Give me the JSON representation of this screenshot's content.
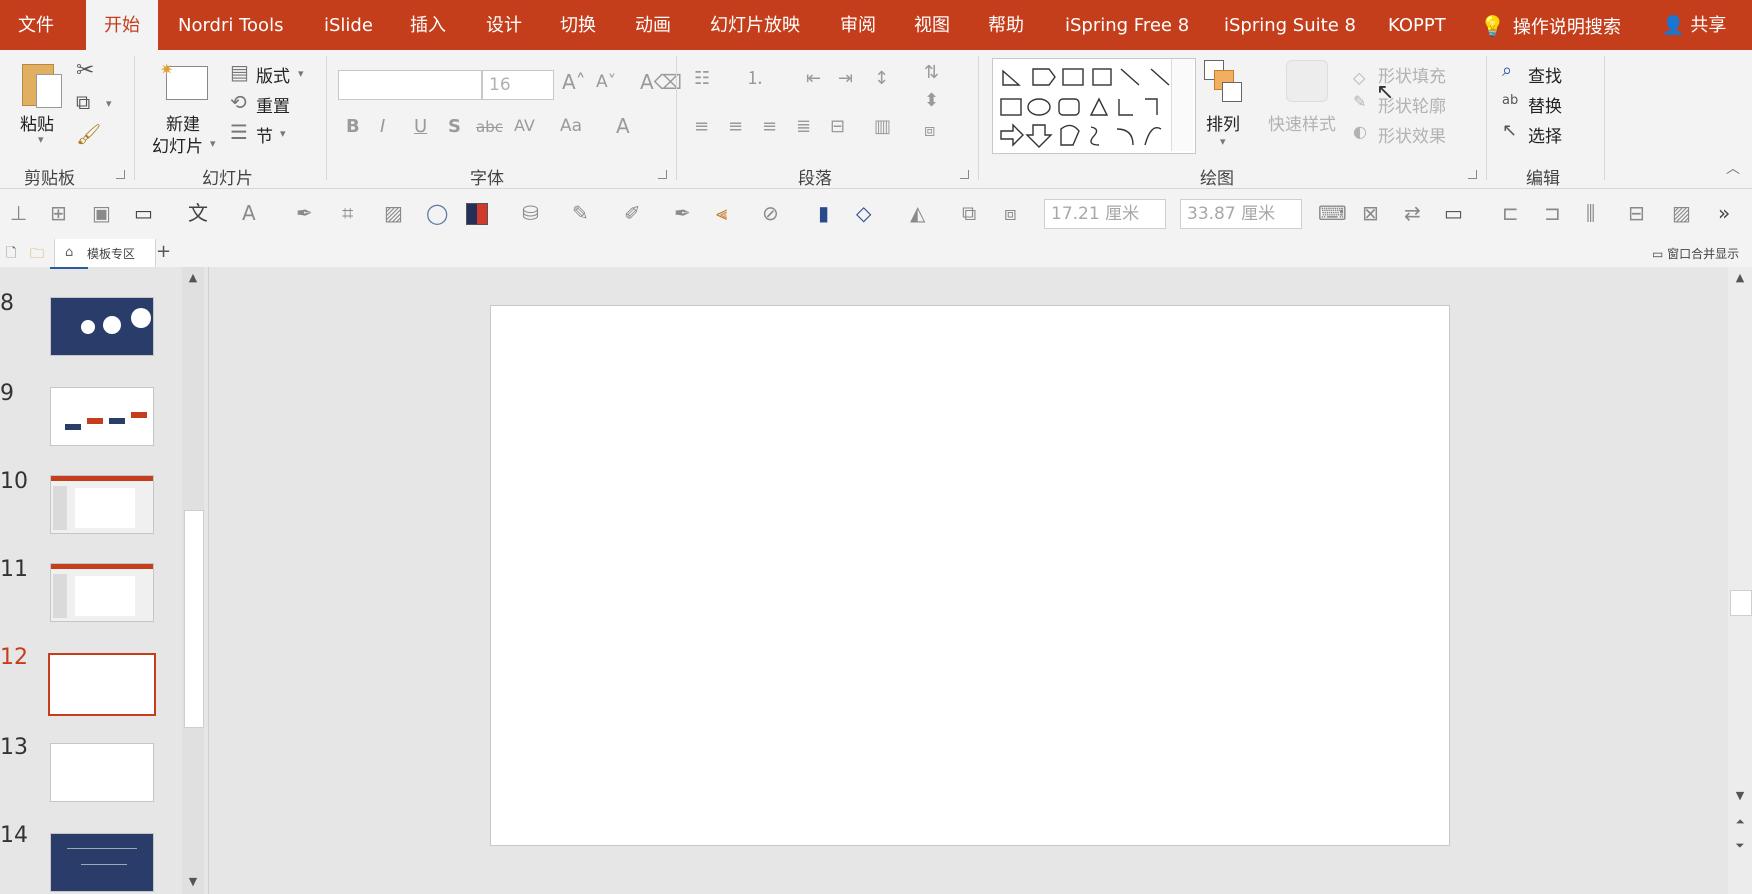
{
  "tabs": [
    "文件",
    "开始",
    "Nordri Tools",
    "iSlide",
    "插入",
    "设计",
    "切换",
    "动画",
    "幻灯片放映",
    "审阅",
    "视图",
    "帮助",
    "iSpring Free 8",
    "iSpring Suite 8",
    "KOPPT"
  ],
  "search_label": "操作说明搜索",
  "share_label": "共享",
  "clipboard": {
    "paste": "粘贴",
    "group": "剪贴板"
  },
  "slides_group": {
    "new_line1": "新建",
    "new_line2": "幻灯片",
    "layout": "版式",
    "reset": "重置",
    "section": "节",
    "group": "幻灯片"
  },
  "font": {
    "name": "",
    "size": "16",
    "group": "字体",
    "bold": "B",
    "italic": "I",
    "underline": "U",
    "shadow": "S",
    "strike": "abc",
    "spacing": "AV",
    "case": "Aa",
    "color": "A"
  },
  "paragraph": {
    "group": "段落"
  },
  "drawing": {
    "arrange": "排列",
    "quick_styles": "快速样式",
    "fill": "形状填充",
    "outline": "形状轮廓",
    "effects": "形状效果",
    "group": "绘图"
  },
  "editing": {
    "find": "查找",
    "replace": "替换",
    "select": "选择",
    "group": "编辑"
  },
  "toolbar": {
    "height": "17.21 厘米",
    "width": "33.87 厘米"
  },
  "doc_tab": "模板专区",
  "window_merge": "窗口合并显示",
  "slides": [
    {
      "num": "8",
      "style": "navy"
    },
    {
      "num": "9",
      "style": "light"
    },
    {
      "num": "10",
      "style": "screen"
    },
    {
      "num": "11",
      "style": "screen"
    },
    {
      "num": "12",
      "style": "blank",
      "selected": true
    },
    {
      "num": "13",
      "style": "blank"
    },
    {
      "num": "14",
      "style": "navy"
    }
  ],
  "colors": {
    "accent": "#c43e1c",
    "ribbon_bg": "#f3f3f3",
    "canvas_bg": "#e6e6e6"
  }
}
